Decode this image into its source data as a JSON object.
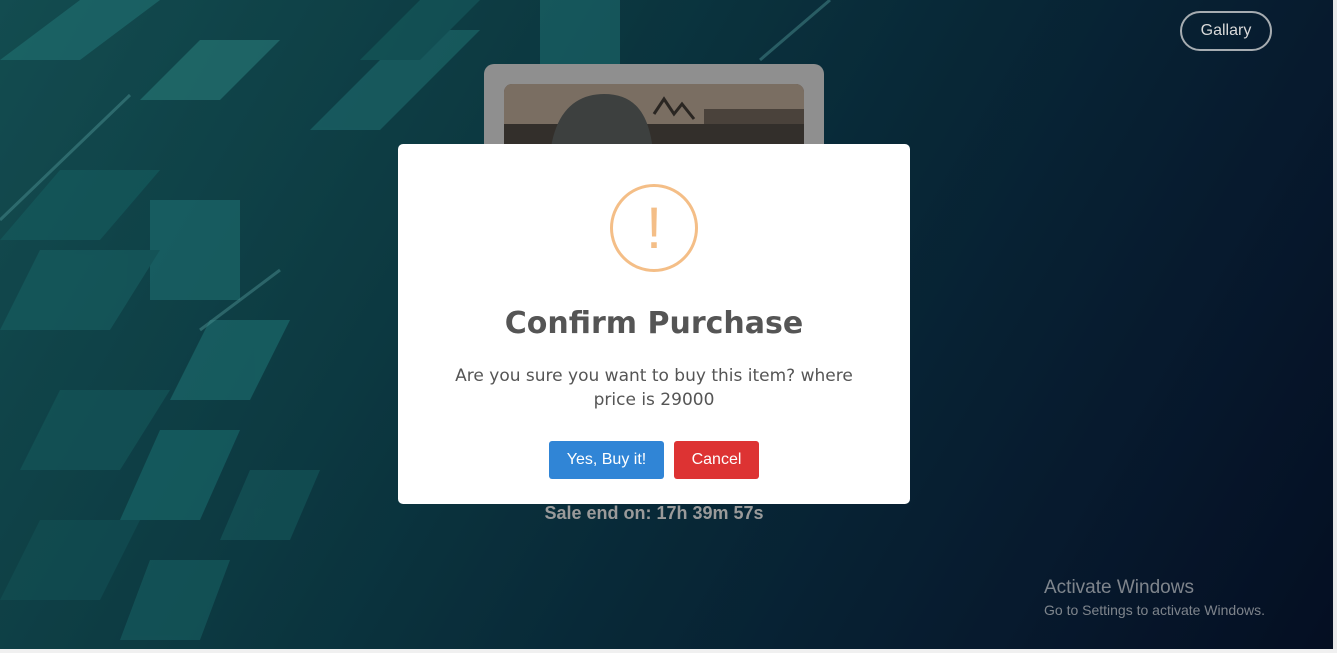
{
  "header": {
    "gallery_label": "Gallary"
  },
  "listing": {
    "sale_end_text": "Sale end on: 17h 39m 57s"
  },
  "modal": {
    "icon": "exclamation-warning-icon",
    "icon_glyph": "!",
    "title": "Confirm Purchase",
    "message": "Are you sure you want to buy this item? where price is 29000",
    "confirm_label": "Yes, Buy it!",
    "cancel_label": "Cancel"
  },
  "watermark": {
    "title": "Activate Windows",
    "subtitle": "Go to Settings to activate Windows."
  },
  "colors": {
    "confirm": "#3085d6",
    "cancel": "#dd3333",
    "warning": "#f4be87"
  }
}
